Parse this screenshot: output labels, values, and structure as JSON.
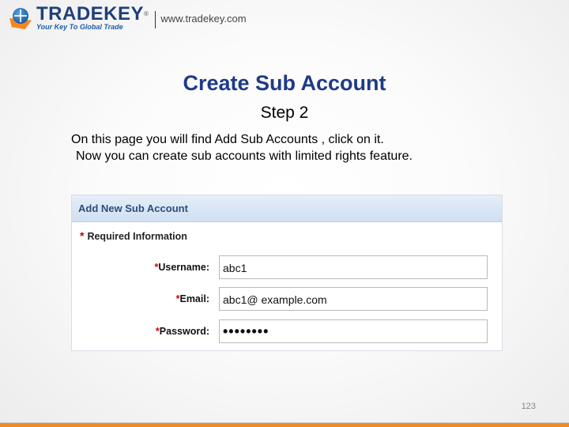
{
  "header": {
    "brand": "TRADEKEY",
    "reg_mark": "®",
    "tagline": "Your Key To Global Trade",
    "url": "www.tradekey.com"
  },
  "slide": {
    "title": "Create Sub Account",
    "step": "Step 2",
    "description": [
      "On this page you will find Add Sub Accounts , click on it.",
      "Now you can create sub accounts with limited rights feature."
    ],
    "page_number": "123"
  },
  "form": {
    "header": "Add New Sub Account",
    "required_star": "*",
    "required_text": "Required Information",
    "fields": [
      {
        "star": "*",
        "label": "Username:",
        "value": "abc1"
      },
      {
        "star": "*",
        "label": "Email:",
        "value": "abc1@ example.com"
      },
      {
        "star": "*",
        "label": "Password:",
        "value": "••••••••"
      }
    ]
  },
  "colors": {
    "title": "#1f3a86",
    "accent": "#f08a24",
    "panel_header": "#2c4d7a",
    "required": "#cc0000"
  }
}
